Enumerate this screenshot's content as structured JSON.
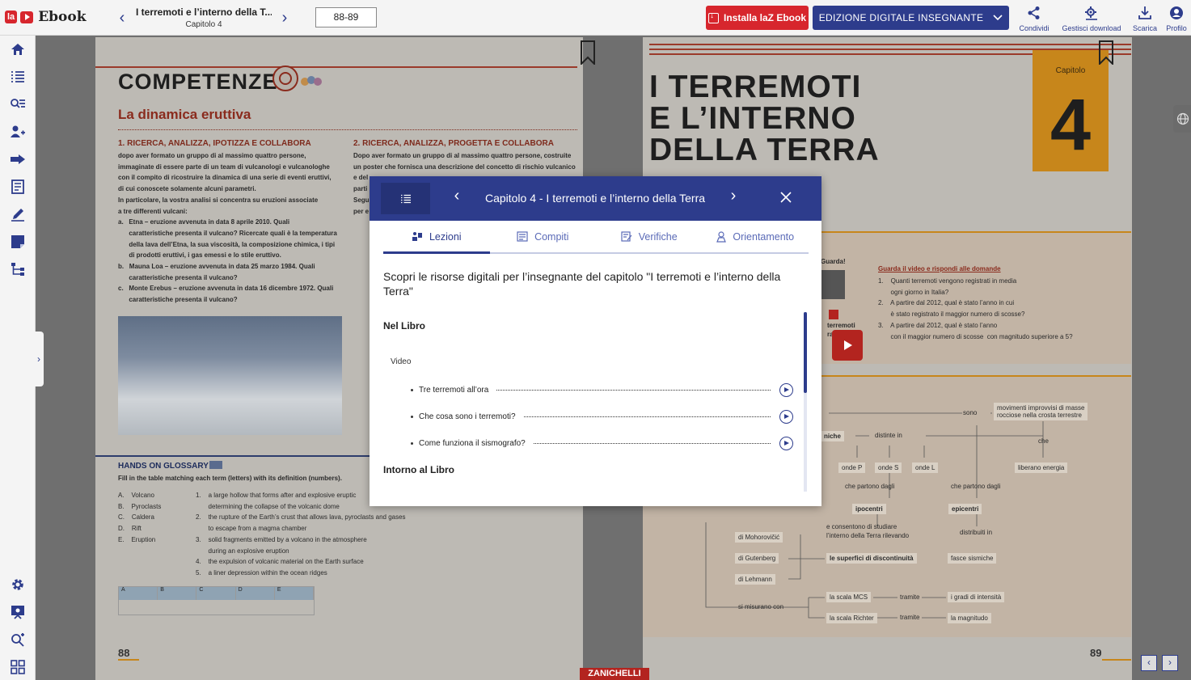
{
  "app": {
    "logo_la": "la",
    "logo_name": "Ebook"
  },
  "header": {
    "book_title": "I terremoti e l’interno della T...",
    "book_subtitle": "Capitolo 4",
    "page_range": "88-89",
    "install_label": "Installa laZ Ebook",
    "edition_label": "EDIZIONE DIGITALE INSEGNANTE",
    "tools": [
      {
        "label": "Condividi",
        "icon": "share-icon"
      },
      {
        "label": "Gestisci download",
        "icon": "manage-download-icon"
      },
      {
        "label": "Scarica",
        "icon": "download-icon"
      },
      {
        "label": "Profilo",
        "icon": "profile-icon"
      }
    ]
  },
  "sidebar": {
    "top_icons": [
      "home-icon",
      "index-list-icon",
      "search-list-icon",
      "users-icon",
      "assign-icon",
      "tasks-icon",
      "pen-icon",
      "notes-icon",
      "map-icon"
    ],
    "bottom_icons": [
      "settings-icon",
      "presentation-icon",
      "zoom-icon",
      "grid-icon"
    ]
  },
  "left_page": {
    "title": "COMPETENZE",
    "subtitle": "La dinamica eruttiva",
    "col1_head": "1. RICERCA, ANALIZZA, IPOTIZZA E COLLABORA",
    "col1_text": [
      "dopo aver formato un gruppo di al massimo quattro persone,",
      "immaginate di essere parte di un team di vulcanologi e vulcanologhe",
      "con il compito di ricostruire la dinamica di una serie di eventi eruttivi,",
      "di cui conoscete solamente alcuni parametri.",
      "In particolare, la vostra analisi si concentra su eruzioni associate",
      "a tre differenti vulcani:",
      "a.   Etna – eruzione avvenuta in data 8 aprile 2010. Quali",
      "      caratteristiche presenta il vulcano? Ricercate quali è la temperatura",
      "      della lava dell’Etna, la sua viscosità, la composizione chimica, i tipi",
      "      di prodotti eruttivi, i gas emessi e lo stile eruttivo.",
      "b.   Mauna Loa – eruzione avvenuta in data 25 marzo 1984. Quali",
      "      caratteristiche presenta il vulcano?",
      "c.   Monte Erebus – eruzione avvenuta in data 16 dicembre 1972. Quali",
      "      caratteristiche presenta il vulcano?"
    ],
    "col2_head": "2. RICERCA, ANALIZZA, PROGETTA E COLLABORA",
    "col2_text": [
      "Dopo aver formato un gruppo di al massimo quattro persone, costruite",
      "un poster che fornisca una descrizione del concetto di rischio vulcanico",
      "e del",
      "parti",
      "Segu",
      "per e"
    ],
    "glossary_head": "HANDS ON GLOSSARY",
    "glossary_sub": "Fill in the table matching each term (letters) with its definition (numbers).",
    "glossary_terms": [
      "A.    Volcano",
      "B.    Pyroclasts",
      "C.    Caldera",
      "D.    Rift",
      "E.    Eruption"
    ],
    "glossary_defs": [
      "1.    a large hollow that forms after and explosive eruptic",
      "       determining the collapse of the volcanic dome",
      "2.    the rupture of the Earth’s crust that allows lava, pyroclasts and gases",
      "       to escape from a magma chamber",
      "3.    solid fragments emitted by a volcano in the atmosphere",
      "       during an explosive eruption",
      "4.    the expulsion of volcanic material on the Earth surface",
      "5.    a liner depression within the ocean ridges"
    ],
    "glossary_table_headers": [
      "A",
      "B",
      "C",
      "D",
      "E"
    ],
    "page_number": "88"
  },
  "right_page": {
    "title_lines": [
      "I TERREMOTI",
      "E L’INTERNO",
      "DELLA TERRA"
    ],
    "chapter_label": "Capitolo",
    "chapter_number": "4",
    "guarda_label": "Guarda!",
    "video_label_lines": [
      "terremoti",
      "ra"
    ],
    "quiz_head": "Guarda il video e rispondi alle domande",
    "quiz_lines": [
      "1.    Quanti terremoti vengono registrati in media",
      "       ogni giorno in Italia?",
      "2.    A partire dal 2012, qual è stato l’anno in cui",
      "       è stato registrato il maggior numero di scosse?",
      "3.    A partire dal 2012, qual è stato l’anno",
      "       con il maggior numero di scosse  con magnitudo superiore a 5?"
    ],
    "map": {
      "sono": "sono",
      "movimenti": "movimenti improvvisi di masse",
      "movimenti2": "rocciose nella crosta terrestre",
      "che": "che",
      "liberano": "liberano energia",
      "niche": "niche",
      "distinte": "distinte in",
      "ondeP": "onde P",
      "ondeS": "onde S",
      "ondeL": "onde L",
      "partono1": "che partono dagli",
      "partono2": "che partono dagli",
      "ipocentri": "ipocentri",
      "epicentri": "epicentri",
      "consentono1": "e consentono di studiare",
      "consentono2": "l’interno della Terra rilevando",
      "distribuiti": "distribuiti in",
      "mohorovicic": "di Mohorovičić",
      "gutenberg": "di Gutenberg",
      "lehmann": "di Lehmann",
      "superfici": "le superfici di discontinuità",
      "fasce": "fasce sismiche",
      "misurano": "si misurano con",
      "mcs": "la scala MCS",
      "richter": "la scala Richter",
      "tramite1": "tramite",
      "tramite2": "tramite",
      "gradi": "i gradi di intensità",
      "magnitudo": "la magnitudo"
    },
    "page_number": "89"
  },
  "publisher": "ZANICHELLI",
  "modal": {
    "title": "Capitolo 4 - I terremoti e l’interno della Terra",
    "tabs": [
      {
        "label": "Lezioni",
        "icon": "lessons-icon",
        "active": true
      },
      {
        "label": "Compiti",
        "icon": "tasks-icon",
        "active": false
      },
      {
        "label": "Verifiche",
        "icon": "tests-icon",
        "active": false
      },
      {
        "label": "Orientamento",
        "icon": "orientation-icon",
        "active": false
      }
    ],
    "intro": "Scopri le risorse digitali per l’insegnante del capitolo \"I terremoti e l’interno della Terra\"",
    "section1": "Nel Libro",
    "subsection1": "Video",
    "resources": [
      "Tre terremoti all’ora",
      "Che cosa sono i terremoti?",
      "Come funziona il sismografo?"
    ],
    "section2": "Intorno al Libro"
  },
  "colors": {
    "primary": "#2d3c8c",
    "accent": "#d7262d",
    "chapter": "#c7861b"
  }
}
